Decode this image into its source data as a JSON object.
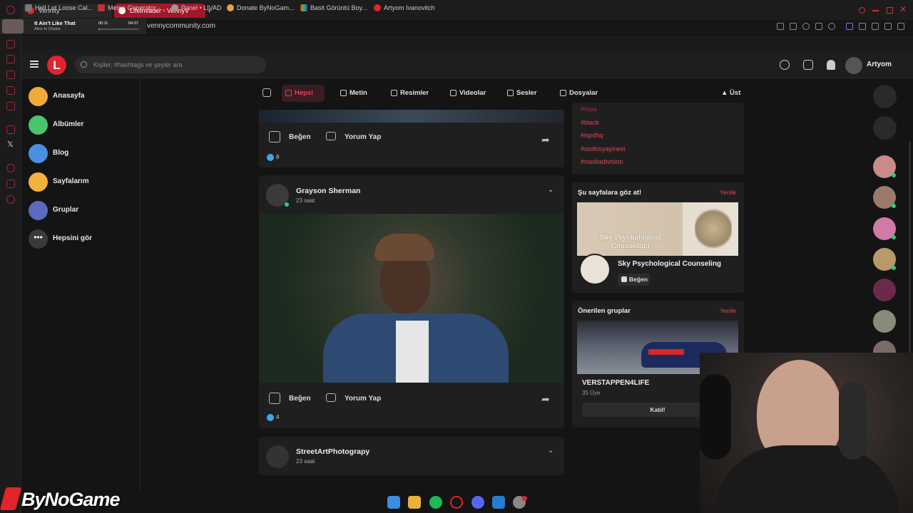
{
  "browser": {
    "tabs": [
      {
        "label": "Vennity",
        "active": false
      },
      {
        "label": "Lifeinvader - VennyV",
        "active": true
      }
    ],
    "address": "vennycommunity.com",
    "bookmarks": [
      "Hell Let Loose Cal...",
      "Meme Generator -...",
      "Panel • LIVAD",
      "Donate ByNoGam...",
      "Basit Görüntü Boy...",
      "Artyom Ivanovitch"
    ]
  },
  "media": {
    "title": "It Ain't Like That",
    "artist": "Alice In Chains",
    "elapsed": "00:11",
    "duration": "04:37",
    "progress": 0.04
  },
  "header": {
    "search_placeholder": "Kişiler, #hashtags ve şeyler ara",
    "username": "Artyom",
    "logo_letter": "L"
  },
  "nav": {
    "items": [
      {
        "label": "Anasayfa",
        "color": "#f2a93b"
      },
      {
        "label": "Albümler",
        "color": "#4cc36d"
      },
      {
        "label": "Blog",
        "color": "#4a90e2"
      },
      {
        "label": "Sayfalarım",
        "color": "#f2b33d"
      },
      {
        "label": "Gruplar",
        "color": "#5c6bc0"
      },
      {
        "label": "Hepsini gör",
        "color": "#3a3a3a"
      }
    ]
  },
  "filters": {
    "items": [
      {
        "label": "Hepsi",
        "active": true
      },
      {
        "label": "Metin",
        "active": false
      },
      {
        "label": "Resimler",
        "active": false
      },
      {
        "label": "Videolar",
        "active": false
      },
      {
        "label": "Sesler",
        "active": false
      },
      {
        "label": "Dosyalar",
        "active": false
      }
    ],
    "top": "Üst"
  },
  "posts": [
    {
      "like_label": "Beğen",
      "comment_label": "Yorum Yap",
      "likes": "8"
    },
    {
      "author": "Grayson Sherman",
      "time": "23 saat",
      "like_label": "Beğen",
      "comment_label": "Yorum Yap",
      "likes": "4"
    },
    {
      "author": "StreetArtPhotograpy",
      "time": "23 saat"
    }
  ],
  "right": {
    "tags": [
      "#mpa",
      "#black",
      "#lspdhq",
      "#sisifosyayinevi",
      "#mediadivision"
    ],
    "pages_title": "Şu sayfalara göz at!",
    "refresh": "Yenile",
    "page_banner_text": "Sky Psychological Counseling",
    "page_name": "Sky Psychological Counseling",
    "page_like": "Beğen",
    "groups_title": "Önerilen gruplar",
    "group_name": "VERSTAPPEN4LIFE",
    "group_members": "35 Üye",
    "group_join": "Katıl!"
  },
  "overlay": {
    "brand": "ByNoGame"
  },
  "colors": {
    "accent": "#e04656",
    "brand_red": "#e3242b",
    "bg": "#141414",
    "card": "#1f1f1f"
  }
}
